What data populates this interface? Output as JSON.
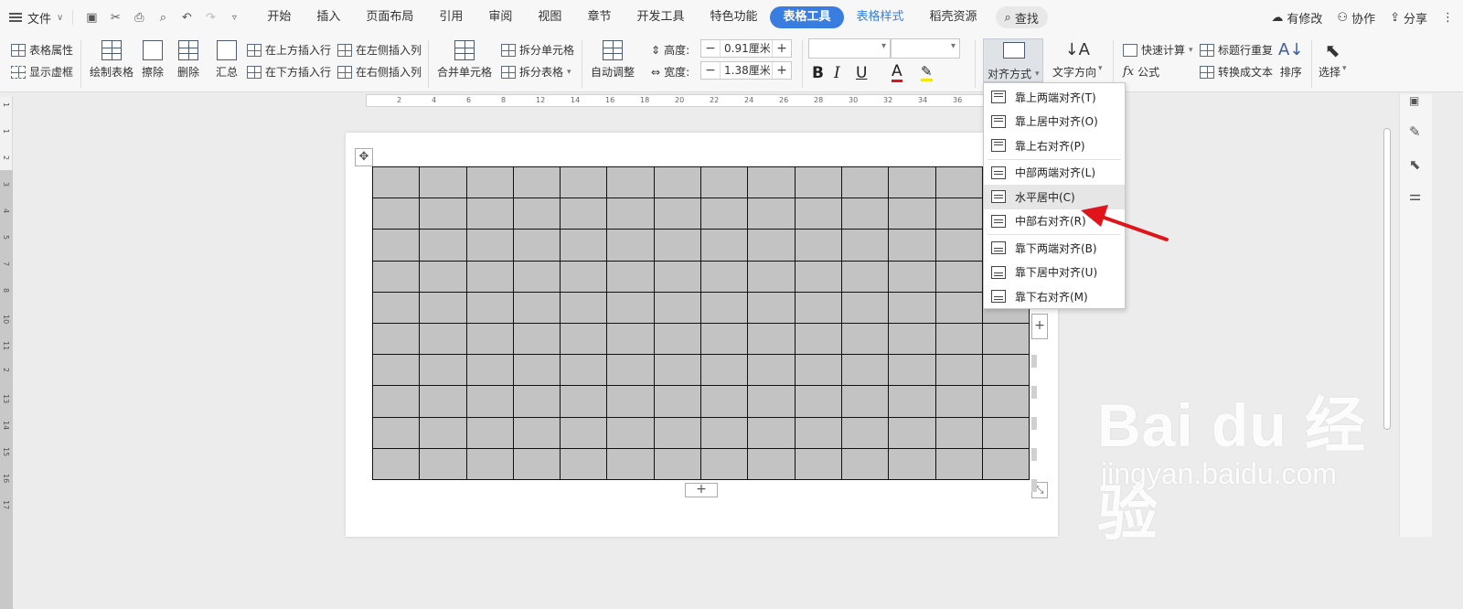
{
  "menubar": {
    "file_label": "文件",
    "tabs": [
      {
        "label": "开始"
      },
      {
        "label": "插入"
      },
      {
        "label": "页面布局"
      },
      {
        "label": "引用"
      },
      {
        "label": "审阅"
      },
      {
        "label": "视图"
      },
      {
        "label": "章节"
      },
      {
        "label": "开发工具"
      },
      {
        "label": "特色功能"
      },
      {
        "label": "表格工具"
      },
      {
        "label": "表格样式"
      },
      {
        "label": "稻壳资源"
      }
    ],
    "search_label": "查找",
    "right": {
      "changes": "有修改",
      "collab": "协作",
      "share": "分享"
    }
  },
  "ribbon": {
    "table_props": "表格属性",
    "show_grid": "显示虚框",
    "draw_table": "绘制表格",
    "erase": "擦除",
    "delete": "删除",
    "summary": "汇总",
    "insert_above": "在上方插入行",
    "insert_below": "在下方插入行",
    "insert_left": "在左侧插入列",
    "insert_right": "在右侧插入列",
    "merge_cells": "合并单元格",
    "split_cells": "拆分单元格",
    "split_table": "拆分表格",
    "auto_fit": "自动调整",
    "height_label": "高度:",
    "height_value": "0.91厘米",
    "width_label": "宽度:",
    "width_value": "1.38厘米",
    "bold": "B",
    "italic": "I",
    "underline": "U",
    "font_color": "A",
    "align": "对齐方式",
    "text_direction": "文字方向",
    "quick_calc": "快速计算",
    "repeat_header": "标题行重复",
    "formula": "公式",
    "to_text": "转换成文本",
    "sort": "排序",
    "select": "选择",
    "plus": "+",
    "minus": "−"
  },
  "ruler": {
    "h_marks": [
      "2",
      "4",
      "6",
      "8",
      "12",
      "14",
      "16",
      "18",
      "20",
      "22",
      "24",
      "26",
      "28",
      "30",
      "32",
      "34",
      "36",
      "38"
    ],
    "v_marks": [
      "1",
      "1",
      "2",
      "3",
      "4",
      "5",
      "7",
      "8",
      "10",
      "11",
      "2",
      "13",
      "14",
      "15",
      "16",
      "17"
    ]
  },
  "table": {
    "rows": 10,
    "cols": 14,
    "add": "+"
  },
  "dropdown": {
    "items": [
      {
        "label": "靠上两端对齐(T)",
        "pos": "top"
      },
      {
        "label": "靠上居中对齐(O)",
        "pos": "top"
      },
      {
        "label": "靠上右对齐(P)",
        "pos": "top"
      },
      {
        "label": "中部两端对齐(L)",
        "pos": "mid"
      },
      {
        "label": "水平居中(C)",
        "pos": "mid"
      },
      {
        "label": "中部右对齐(R)",
        "pos": "mid"
      },
      {
        "label": "靠下两端对齐(B)",
        "pos": "bot"
      },
      {
        "label": "靠下居中对齐(U)",
        "pos": "bot"
      },
      {
        "label": "靠下右对齐(M)",
        "pos": "bot"
      }
    ],
    "hovered_index": 4
  },
  "watermark": {
    "logo": "Bai du 经验",
    "url": "jingyan.baidu.com"
  },
  "colors": {
    "accent": "#3a7de0",
    "arrow": "#e0151b",
    "cell": "#c3c3c3"
  }
}
